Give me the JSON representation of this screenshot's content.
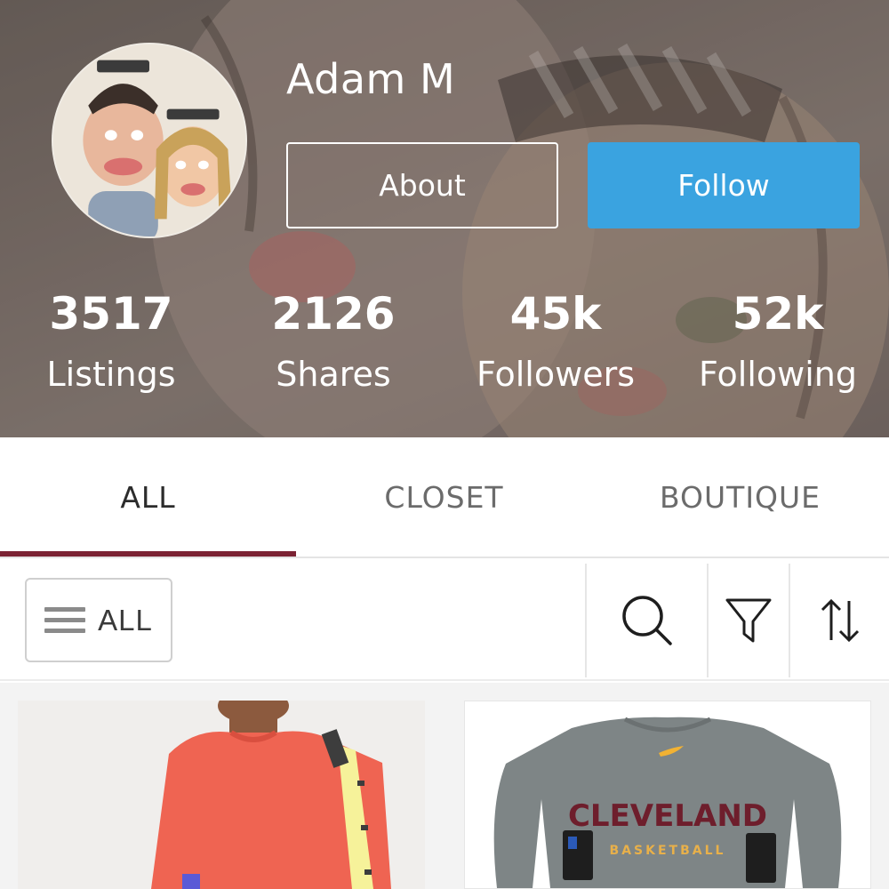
{
  "profile": {
    "name": "Adam M",
    "about_label": "About",
    "follow_label": "Follow",
    "follow_color": "#3aa3e0"
  },
  "stats": [
    {
      "value": "3517",
      "label": "Listings"
    },
    {
      "value": "2126",
      "label": "Shares"
    },
    {
      "value": "45k",
      "label": "Followers"
    },
    {
      "value": "52k",
      "label": "Following"
    }
  ],
  "tabs": [
    {
      "label": "ALL",
      "active": true
    },
    {
      "label": "CLOSET",
      "active": false
    },
    {
      "label": "BOUTIQUE",
      "active": false
    }
  ],
  "tab_indicator_color": "#7b2233",
  "filter": {
    "all_label": "ALL",
    "icons": [
      "menu-icon",
      "search-icon",
      "filter-icon",
      "sort-icon"
    ]
  },
  "listings": [
    {
      "image": "red-long-sleeve-shirt"
    },
    {
      "image": "gray-cleveland-basketball-shirt",
      "print_text": "CLEVELAND",
      "print_subtext": "BASKETBALL"
    }
  ]
}
